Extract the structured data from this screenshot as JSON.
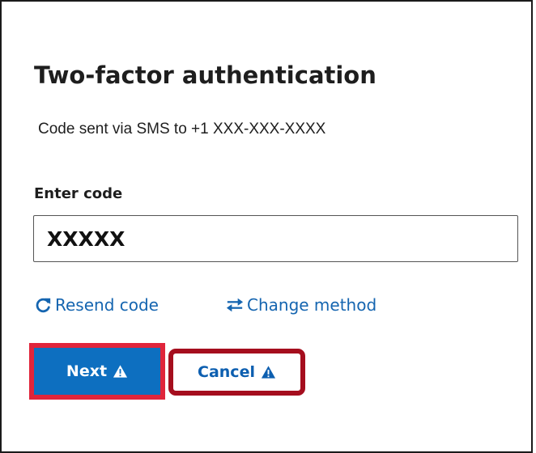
{
  "dialog": {
    "title": "Two-factor authentication",
    "subtitle": "Code sent via SMS to +1 XXX-XXX-XXXX"
  },
  "code_field": {
    "label": "Enter code",
    "value": "XXXXX"
  },
  "links": {
    "resend_label": "Resend code",
    "change_method_label": "Change method"
  },
  "buttons": {
    "next_label": "Next",
    "cancel_label": "Cancel"
  },
  "icons": {
    "resend": "refresh-icon",
    "change_method": "swap-arrows-icon",
    "next_badge": "warning-icon",
    "cancel_badge": "warning-icon"
  },
  "colors": {
    "primary": "#0d6fc0",
    "link": "#1565b0",
    "next_highlight": "#e0253b",
    "cancel_highlight": "#a50e1e"
  }
}
